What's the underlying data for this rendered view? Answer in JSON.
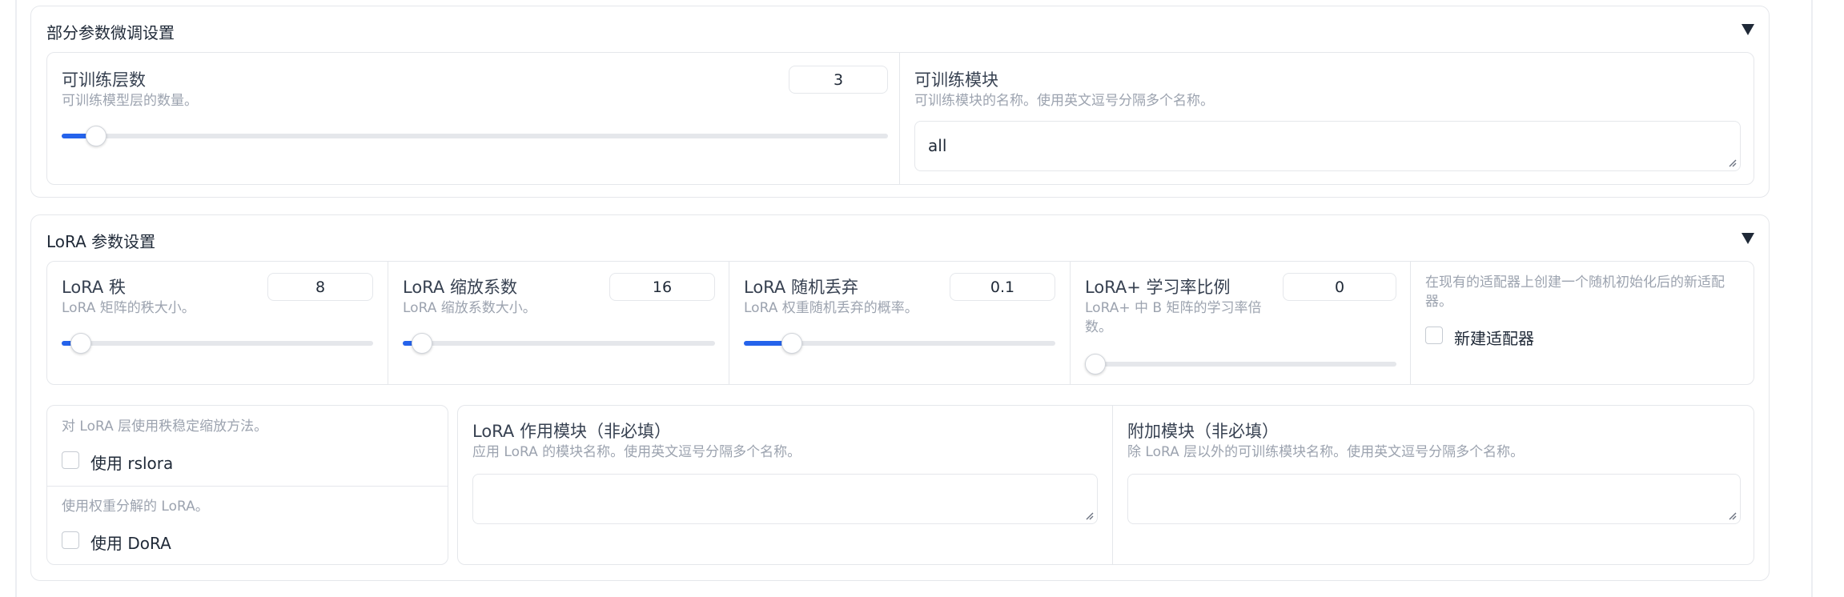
{
  "partial": {
    "title": "部分参数微调设置",
    "layers": {
      "label": "可训练层数",
      "info": "可训练模型层的数量。",
      "value": "3",
      "level": 0.03
    },
    "modules": {
      "label": "可训练模块",
      "info": "可训练模块的名称。使用英文逗号分隔多个名称。",
      "value": "all"
    }
  },
  "lora": {
    "title": "LoRA 参数设置",
    "rank": {
      "label": "LoRA 秩",
      "info": "LoRA 矩阵的秩大小。",
      "value": "8",
      "level": 0.03
    },
    "alpha": {
      "label": "LoRA 缩放系数",
      "info": "LoRA 缩放系数大小。",
      "value": "16",
      "level": 0.03
    },
    "dropout": {
      "label": "LoRA 随机丢弃",
      "info": "LoRA 权重随机丢弃的概率。",
      "value": "0.1",
      "level": 0.13
    },
    "plus_ratio": {
      "label": "LoRA+ 学习率比例",
      "info": "LoRA+ 中 B 矩阵的学习率倍数。",
      "value": "0",
      "level": 0.0
    },
    "new_adapter": {
      "info": "在现有的适配器上创建一个随机初始化后的新适配器。",
      "label": "新建适配器",
      "checked": false
    },
    "rslora": {
      "info": "对 LoRA 层使用秩稳定缩放方法。",
      "label": "使用 rslora",
      "checked": false
    },
    "dora": {
      "info": "使用权重分解的 LoRA。",
      "label": "使用 DoRA",
      "checked": false
    },
    "target": {
      "label": "LoRA 作用模块（非必填）",
      "info": "应用 LoRA 的模块名称。使用英文逗号分隔多个名称。",
      "value": ""
    },
    "additional": {
      "label": "附加模块（非必填）",
      "info": "除 LoRA 层以外的可训练模块名称。使用英文逗号分隔多个名称。",
      "value": ""
    }
  },
  "colors": {
    "accent": "#2563eb",
    "border": "#e5e7eb",
    "info_text": "#9ca3af"
  },
  "icons": {
    "collapse": "triangle-down-icon",
    "resize": "resize-grip-icon"
  }
}
